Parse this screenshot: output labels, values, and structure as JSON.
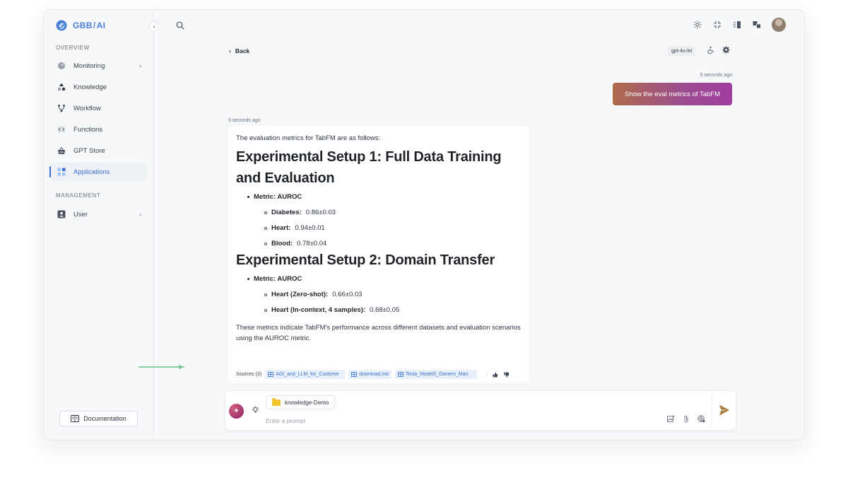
{
  "brand": {
    "name": "GBB",
    "sep": "/",
    "suffix": "AI",
    "accent": "#4a7fd8"
  },
  "sidebar": {
    "overview_label": "OVERVIEW",
    "management_label": "MANAGEMENT",
    "items": [
      {
        "label": "Monitoring",
        "icon": "gauge-icon",
        "has_chevron": true
      },
      {
        "label": "Knowledge",
        "icon": "shapes-icon"
      },
      {
        "label": "Workflow",
        "icon": "branch-icon"
      },
      {
        "label": "Functions",
        "icon": "code-icon"
      },
      {
        "label": "GPT Store",
        "icon": "basket-icon"
      },
      {
        "label": "Applications",
        "icon": "grid-icon",
        "active": true
      },
      {
        "label": "User",
        "icon": "user-card-icon",
        "has_chevron": true
      }
    ],
    "documentation_label": "Documentation"
  },
  "topbar": {
    "icons": [
      "sun-icon",
      "collapse-icon",
      "panel-icon",
      "translate-icon",
      "avatar"
    ]
  },
  "chat": {
    "back_label": "Back",
    "model_tag": "gpt-4o-lei",
    "user_message": {
      "timestamp": "5 seconds ago",
      "text": "Show the eval metrics of TabFM",
      "gradient": [
        "#b06a4a",
        "#9c4f8c",
        "#a03ca0"
      ]
    },
    "answer": {
      "timestamp": "5 seconds ago",
      "intro": "The evaluation metrics for TabFM are as follows:",
      "setup1_title": "Experimental Setup 1: Full Data Training and Evaluation",
      "setup1_metric": "Metric: AUROC",
      "setup1_items": [
        {
          "label": "Diabetes:",
          "value": "0.86±0.03"
        },
        {
          "label": "Heart:",
          "value": "0.94±0.01"
        },
        {
          "label": "Blood:",
          "value": "0.78±0.04"
        }
      ],
      "setup2_title": "Experimental Setup 2: Domain Transfer",
      "setup2_metric": "Metric: AUROC",
      "setup2_items": [
        {
          "label": "Heart (Zero-shot):",
          "value": "0.66±0.03"
        },
        {
          "label": "Heart (In-context, 4 samples):",
          "value": "0.68±0.05"
        }
      ],
      "summary": "These metrics indicate TabFM's performance across different datasets and evaluation scenarios using the AUROC metric.",
      "sources_label": "Sources (3)",
      "sources": [
        "AGI_and_LLM_for_Custome",
        "download.md",
        "Tesla_Model3_Owners_Man"
      ]
    }
  },
  "prompt": {
    "knowledge_chip": "knowledge-Demo",
    "placeholder": "Enter a prompt",
    "value": ""
  },
  "colors": {
    "accent": "#3a6fd1",
    "annotation_arrow": "#7cc79a",
    "folder": "#f4c531",
    "send": "#a67c3c"
  }
}
